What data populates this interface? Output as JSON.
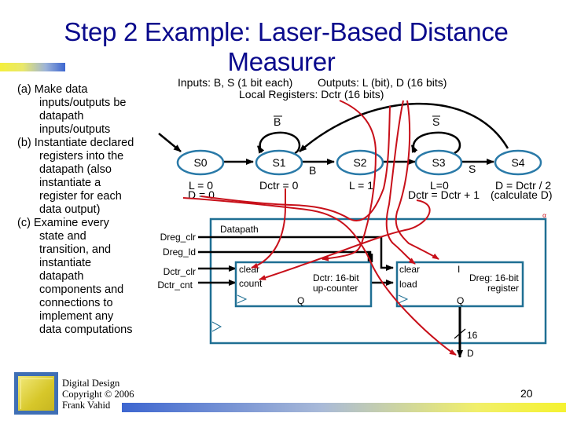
{
  "slide": {
    "title_line1": "Step 2 Example: Laser-Based Distance",
    "title_line2": "Measurer",
    "page_number": "20",
    "colors": {
      "title": "#0a0a8c",
      "state_outline": "#2a7aa8",
      "datapath_outline": "#1f6f93",
      "annotation": "#c8101a"
    }
  },
  "bullets": [
    {
      "lead": "(a) Make data",
      "cont": [
        "inputs/outputs be",
        "datapath",
        "inputs/outputs"
      ]
    },
    {
      "lead": "(b) Instantiate declared",
      "cont": [
        "registers into the",
        "datapath (also",
        "instantiate a",
        "register for each",
        "data output)"
      ]
    },
    {
      "lead": "(c) Examine every",
      "cont": [
        "state and",
        "transition, and",
        "instantiate",
        "datapath",
        "components and",
        "connections to",
        "implement any",
        "data computations"
      ]
    }
  ],
  "footer": {
    "line1": "Digital Design",
    "line2": "Copyright © 2006",
    "line3": "Frank Vahid"
  },
  "fsm": {
    "header_inputs": "Inputs: B, S (1 bit each)",
    "header_outputs": "Outputs: L (bit), D (16 bits)",
    "header_registers": "Local Registers: Dctr (16 bits)",
    "states": [
      {
        "name": "S0",
        "actions": [
          "L = 0",
          "D = 0"
        ]
      },
      {
        "name": "S1",
        "actions": [
          "Dctr = 0"
        ]
      },
      {
        "name": "S2",
        "actions": [
          "L = 1"
        ]
      },
      {
        "name": "S3",
        "actions": [
          "L=0",
          "Dctr = Dctr + 1"
        ]
      },
      {
        "name": "S4",
        "actions": [
          "D = Dctr / 2",
          "(calculate D)"
        ]
      }
    ],
    "transitions": [
      {
        "from": "S0",
        "to": "S1",
        "label": ""
      },
      {
        "from": "S1",
        "to": "S1",
        "label": "B'"
      },
      {
        "from": "S1",
        "to": "S2",
        "label": "B"
      },
      {
        "from": "S2",
        "to": "S3",
        "label": ""
      },
      {
        "from": "S3",
        "to": "S3",
        "label": "S'"
      },
      {
        "from": "S3",
        "to": "S4",
        "label": "S"
      },
      {
        "from": "S4",
        "to": "S1",
        "label": ""
      }
    ],
    "labels": {
      "b_bar": "B",
      "b": "B",
      "s_bar": "S",
      "s": "S"
    }
  },
  "datapath": {
    "title": "Datapath",
    "control_inputs": [
      "Dreg_clr",
      "Dreg_ld",
      "Dctr_clr",
      "Dctr_cnt"
    ],
    "counter": {
      "ports": [
        "clear",
        "count"
      ],
      "name_line1": "Dctr: 16-bit",
      "name_line2": "up-counter",
      "output": "Q"
    },
    "register": {
      "ports": [
        "clear",
        "load"
      ],
      "input": "I",
      "name_line1": "Dreg: 16-bit",
      "name_line2": "register",
      "output": "Q"
    },
    "bus_width": "16",
    "output_name": "D",
    "mark": "α"
  }
}
